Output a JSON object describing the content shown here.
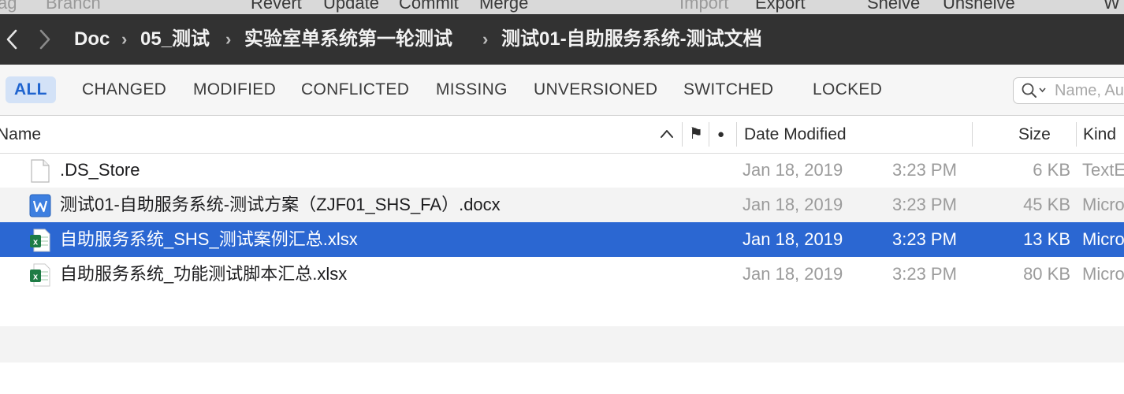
{
  "toolbar_strip": {
    "items": [
      "Tag",
      "Branch",
      "Revert",
      "Update",
      "Commit",
      "Merge",
      "Import",
      "Export",
      "Shelve",
      "Unshelve",
      "W"
    ]
  },
  "breadcrumb": {
    "items": [
      "Doc",
      "05_测试",
      "实验室单系统第一轮测试",
      "测试01-自助服务系统-测试文档"
    ],
    "separator": "›"
  },
  "filters": {
    "tabs": [
      "ALL",
      "CHANGED",
      "MODIFIED",
      "CONFLICTED",
      "MISSING",
      "UNVERSIONED",
      "SWITCHED",
      "LOCKED"
    ],
    "active": "ALL",
    "search_placeholder": "Name, Au"
  },
  "columns": {
    "name": "Name",
    "flag_symbol": "⚑",
    "dot_symbol": "●",
    "date_modified": "Date Modified",
    "size": "Size",
    "kind": "Kind"
  },
  "files": [
    {
      "name": ".DS_Store",
      "icon": "blank-file-icon",
      "date": "Jan 18, 2019",
      "time": "3:23 PM",
      "size": "6 KB",
      "kind": "TextE"
    },
    {
      "name": "测试01-自助服务系统-测试方案（ZJF01_SHS_FA）.docx",
      "icon": "word-document-icon",
      "date": "Jan 18, 2019",
      "time": "3:23 PM",
      "size": "45 KB",
      "kind": "Micro"
    },
    {
      "name": "自助服务系统_SHS_测试案例汇总.xlsx",
      "icon": "excel-spreadsheet-icon",
      "date": "Jan 18, 2019",
      "time": "3:23 PM",
      "size": "13 KB",
      "kind": "Micro"
    },
    {
      "name": "自助服务系统_功能测试脚本汇总.xlsx",
      "icon": "excel-spreadsheet-icon",
      "date": "Jan 18, 2019",
      "time": "3:23 PM",
      "size": "80 KB",
      "kind": "Micro"
    }
  ],
  "selected_row_index": 2,
  "colors": {
    "path_bar": "#323232",
    "selection": "#2b67d2",
    "active_tab_bg": "#d3e2f7",
    "active_tab_text": "#1f64cf"
  }
}
